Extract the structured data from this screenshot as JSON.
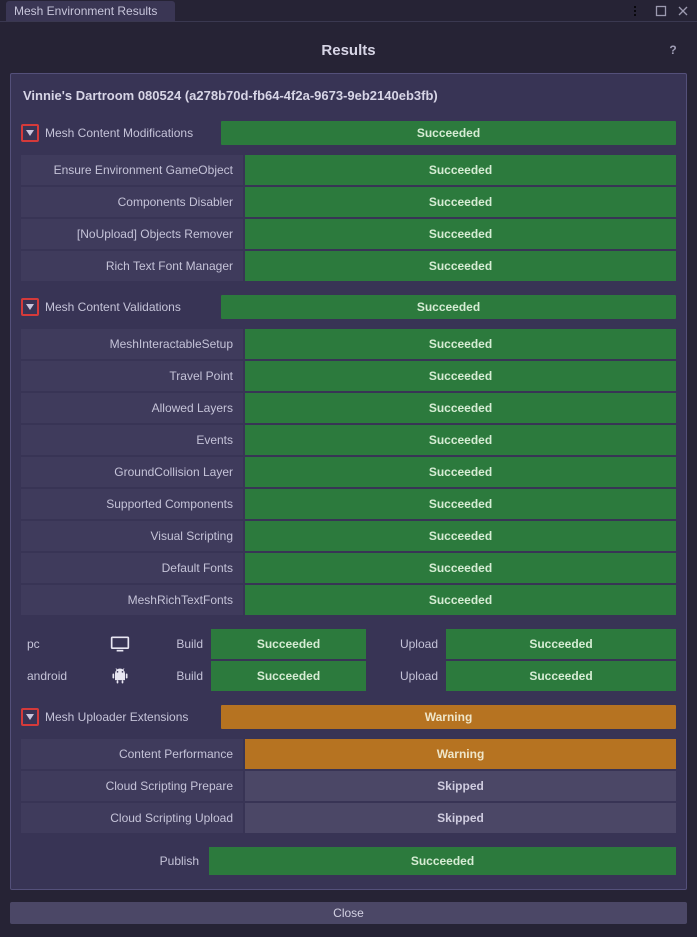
{
  "window": {
    "title": "Mesh Environment Results"
  },
  "header": {
    "title": "Results"
  },
  "environment": {
    "name": "Vinnie's Dartroom 080524 (a278b70d-fb64-4f2a-9673-9eb2140eb3fb)"
  },
  "sections": {
    "modifications": {
      "label": "Mesh Content Modifications",
      "status": "Succeeded",
      "items": [
        {
          "label": "Ensure Environment GameObject",
          "status": "Succeeded"
        },
        {
          "label": "Components Disabler",
          "status": "Succeeded"
        },
        {
          "label": "[NoUpload] Objects Remover",
          "status": "Succeeded"
        },
        {
          "label": "Rich Text Font Manager",
          "status": "Succeeded"
        }
      ]
    },
    "validations": {
      "label": "Mesh Content Validations",
      "status": "Succeeded",
      "items": [
        {
          "label": "MeshInteractableSetup",
          "status": "Succeeded"
        },
        {
          "label": "Travel Point",
          "status": "Succeeded"
        },
        {
          "label": "Allowed Layers",
          "status": "Succeeded"
        },
        {
          "label": "Events",
          "status": "Succeeded"
        },
        {
          "label": "GroundCollision Layer",
          "status": "Succeeded"
        },
        {
          "label": "Supported Components",
          "status": "Succeeded"
        },
        {
          "label": "Visual Scripting",
          "status": "Succeeded"
        },
        {
          "label": "Default Fonts",
          "status": "Succeeded"
        },
        {
          "label": "MeshRichTextFonts",
          "status": "Succeeded"
        }
      ]
    },
    "platforms": [
      {
        "name": "pc",
        "icon": "monitor",
        "build_label": "Build",
        "build_status": "Succeeded",
        "upload_label": "Upload",
        "upload_status": "Succeeded"
      },
      {
        "name": "android",
        "icon": "android",
        "build_label": "Build",
        "build_status": "Succeeded",
        "upload_label": "Upload",
        "upload_status": "Succeeded"
      }
    ],
    "uploader": {
      "label": "Mesh Uploader Extensions",
      "status": "Warning",
      "items": [
        {
          "label": "Content Performance",
          "status": "Warning"
        },
        {
          "label": "Cloud Scripting Prepare",
          "status": "Skipped"
        },
        {
          "label": "Cloud Scripting Upload",
          "status": "Skipped"
        }
      ]
    },
    "publish": {
      "label": "Publish",
      "status": "Succeeded"
    }
  },
  "buttons": {
    "close": "Close"
  }
}
